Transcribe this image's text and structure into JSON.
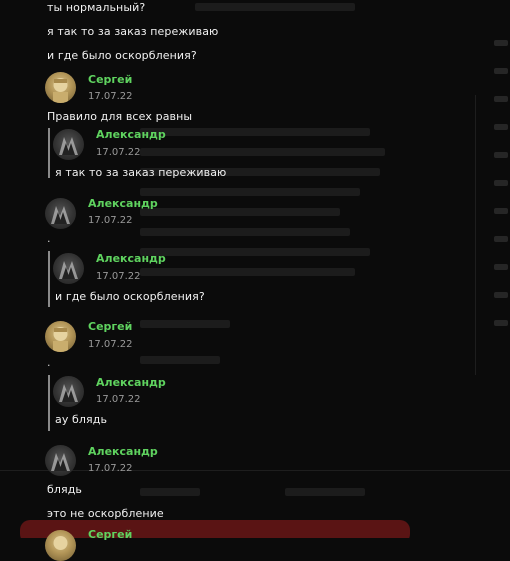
{
  "messages": {
    "line1": "ты нормальный?",
    "line2": "я так то за заказ переживаю",
    "line3": "и где было оскорбления?"
  },
  "posts": [
    {
      "author": "Сергей",
      "date": "17.07.22",
      "avatar": "sergey-avatar",
      "text": "Правило для всех равны",
      "quote": {
        "author": "Александр",
        "date": "17.07.22",
        "avatar": "alexander-avatar",
        "text": "я так то за заказ переживаю"
      }
    },
    {
      "author": "Александр",
      "date": "17.07.22",
      "avatar": "alexander-avatar",
      "text": ".",
      "quote": {
        "author": "Александр",
        "date": "17.07.22",
        "avatar": "alexander-avatar",
        "text": "и где было оскорбления?"
      }
    },
    {
      "author": "Сергей",
      "date": "17.07.22",
      "avatar": "sergey-avatar",
      "text": ".",
      "quote": {
        "author": "Александр",
        "date": "17.07.22",
        "avatar": "alexander-avatar",
        "text": "ау блядь"
      }
    },
    {
      "author": "Александр",
      "date": "17.07.22",
      "avatar": "alexander-avatar",
      "text": "блядь",
      "text2": "это не оскорбление"
    },
    {
      "author": "Сергей",
      "avatar": "sergey-avatar"
    }
  ],
  "colors": {
    "background": "#0b0b0b",
    "author_name": "#5fd35f",
    "date": "#9a9a9a",
    "text": "#f2f2f2",
    "quote_bar": "#8a8a8a"
  }
}
